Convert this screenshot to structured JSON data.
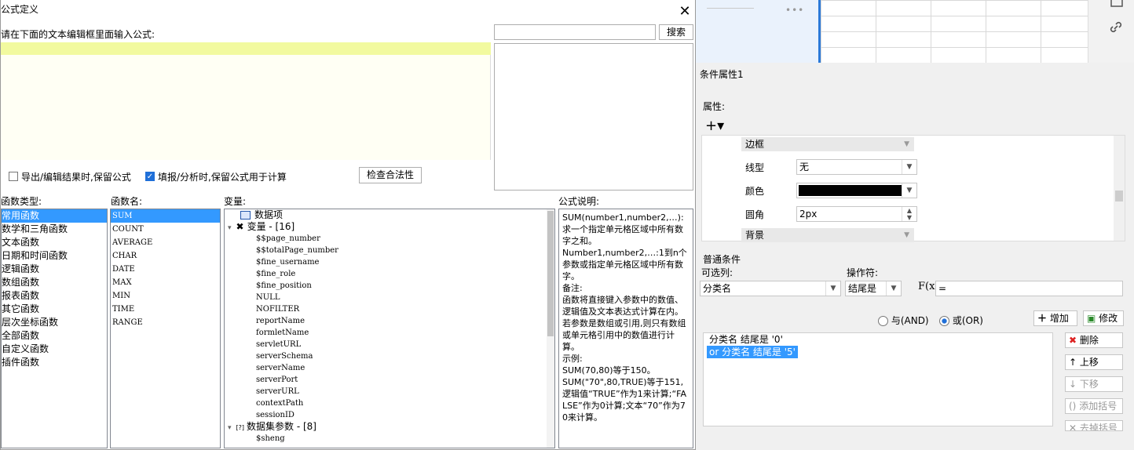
{
  "dialog": {
    "title": "公式定义",
    "close": "✕",
    "hint": "请在下面的文本编辑框里面输入公式:",
    "search_button": "搜索",
    "option_keep_export": "导出/编辑结果时,保留公式",
    "option_keep_calc": "填报/分析时,保留公式用于计算",
    "check_button": "检查合法性",
    "headers": {
      "types": "函数类型:",
      "funcs": "函数名:",
      "vars": "变量:",
      "desc": "公式说明:"
    },
    "function_types": [
      "常用函数",
      "数学和三角函数",
      "文本函数",
      "日期和时间函数",
      "逻辑函数",
      "数组函数",
      "报表函数",
      "其它函数",
      "层次坐标函数",
      "全部函数",
      "自定义函数",
      "插件函数"
    ],
    "function_names": [
      "SUM",
      "COUNT",
      "AVERAGE",
      "CHAR",
      "DATE",
      "MAX",
      "MIN",
      "TIME",
      "RANGE"
    ],
    "variables": {
      "data_items": "数据项",
      "variables_group": "变量 - [16]",
      "items": [
        "$$page_number",
        "$$totalPage_number",
        "$fine_username",
        "$fine_role",
        "$fine_position",
        "NULL",
        "NOFILTER",
        "reportName",
        "formletName",
        "servletURL",
        "serverSchema",
        "serverName",
        "serverPort",
        "serverURL",
        "contextPath",
        "sessionID"
      ],
      "dataset_group": "数据集参数 - [8]",
      "dataset_items": [
        "$sheng"
      ]
    },
    "description": "SUM(number1,number2,…):求一个指定单元格区域中所有数字之和。\nNumber1,number2,…:1到n个参数或指定单元格区域中所有数字。\n备注:\n函数将直接键入参数中的数值、逻辑值及文本表达式计算在内。若参数是数组或引用,则只有数组或单元格引用中的数值进行计算。\n示例:\nSUM(70,80)等于150。\nSUM(\"70\",80,TRUE)等于151,逻辑值“TRUE”作为1来计算;“FALSE”作为0计算;文本“70”作为70来计算。"
  },
  "bg": {
    "dots": "•••"
  },
  "conditions": {
    "title": "条件属性1",
    "attr_label": "属性:",
    "add_label": "+▾",
    "border_header": "边框",
    "line_type_label": "线型",
    "line_type_value": "无",
    "color_label": "颜色",
    "color_value": "#000000",
    "radius_label": "圆角",
    "radius_value": "2px",
    "background_header": "背景",
    "normal_label": "普通条件",
    "columns_label": "可选列:",
    "operator_label": "操作符:",
    "column_value": "分类名",
    "operator_value": "结尾是",
    "fx": "F(x)",
    "value": "=",
    "and_label": "与(AND)",
    "or_label": "或(OR)",
    "add_button": "增加",
    "edit_button": "修改",
    "delete_button": "删除",
    "up_button": "上移",
    "down_button": "下移",
    "bracket_button": "添加括号",
    "unbracket_button": "去掉括号",
    "cond_row1": "分类名 结尾是 '0'",
    "cond_row2": "or  分类名 结尾是 '5'"
  }
}
